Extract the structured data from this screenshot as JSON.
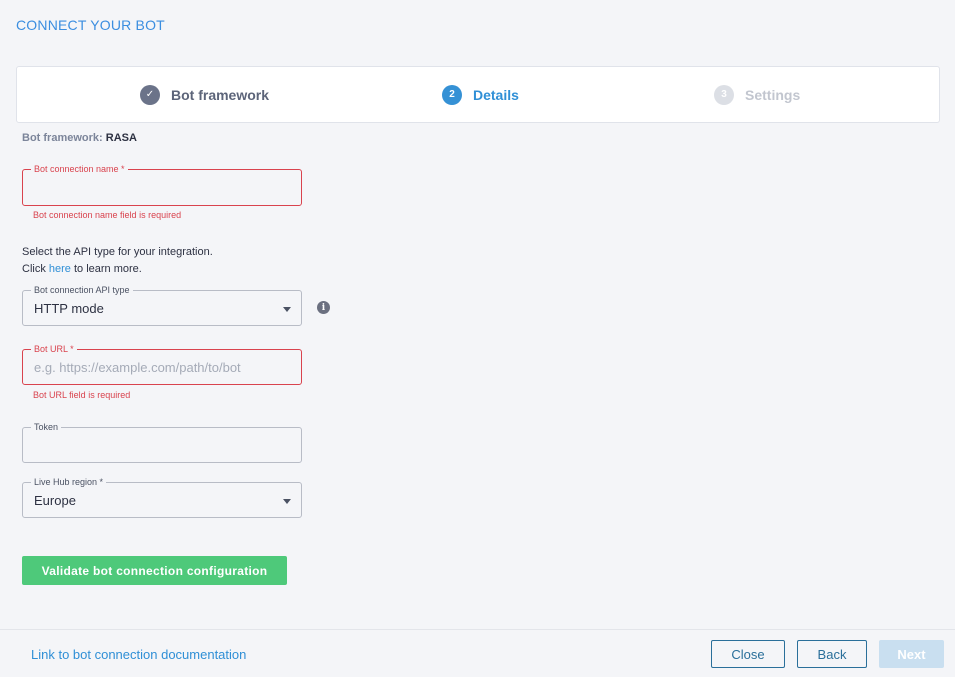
{
  "header": {
    "title": "CONNECT YOUR BOT"
  },
  "stepper": {
    "steps": [
      {
        "label": "Bot framework",
        "marker": "✓",
        "state": "completed"
      },
      {
        "label": "Details",
        "marker": "2",
        "state": "active"
      },
      {
        "label": "Settings",
        "marker": "3",
        "state": "upcoming"
      }
    ]
  },
  "framework": {
    "label": "Bot framework:",
    "value": "RASA"
  },
  "fields": {
    "connection_name": {
      "label": "Bot connection name *",
      "value": "",
      "error": "Bot connection name field is required"
    },
    "api_type": {
      "label": "Bot connection API type",
      "value": "HTTP mode"
    },
    "bot_url": {
      "label": "Bot URL *",
      "placeholder": "e.g. https://example.com/path/to/bot",
      "error": "Bot URL field is required"
    },
    "token": {
      "label": "Token",
      "value": ""
    },
    "region": {
      "label": "Live Hub region *",
      "value": "Europe"
    }
  },
  "api_hint": {
    "line1": "Select the API type for your integration.",
    "line2_prefix": "Click ",
    "link": "here",
    "line2_suffix": " to learn more."
  },
  "validate_button": "Validate bot connection configuration",
  "footer": {
    "doc_link": "Link to bot connection documentation",
    "close": "Close",
    "back": "Back",
    "next": "Next"
  },
  "colors": {
    "accent": "#2f8fd6",
    "error": "#d9434e",
    "success": "#4ec97a",
    "background": "#f4f5f8"
  },
  "icons": {
    "completed_step": "check-icon",
    "info": "info-icon",
    "dropdown": "chevron-down-icon"
  }
}
